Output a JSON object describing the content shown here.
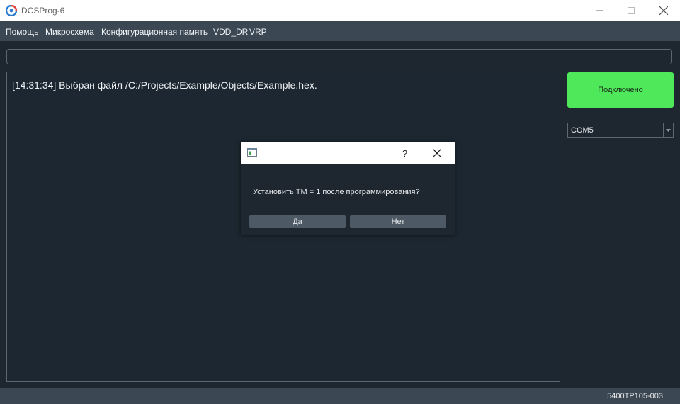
{
  "window": {
    "title": "DCSProg-6"
  },
  "menu": {
    "items": [
      "Помощь",
      "Микросхема",
      "Конфигурационная память",
      "VDD_DR",
      "VRP"
    ]
  },
  "log": {
    "lines": [
      "[14:31:34] Выбран файл /C:/Projects/Example/Objects/Example.hex."
    ]
  },
  "connection": {
    "button_label": "Подключено",
    "port": "COM5"
  },
  "statusbar": {
    "text": "5400TP105-003"
  },
  "dialog": {
    "help": "?",
    "message": "Установить TM = 1 после программирования?",
    "yes_label": "Да",
    "no_label": "Нет"
  },
  "colors": {
    "accent": "#4fe85a",
    "bg": "#1e2730",
    "bar": "#3b4753"
  }
}
